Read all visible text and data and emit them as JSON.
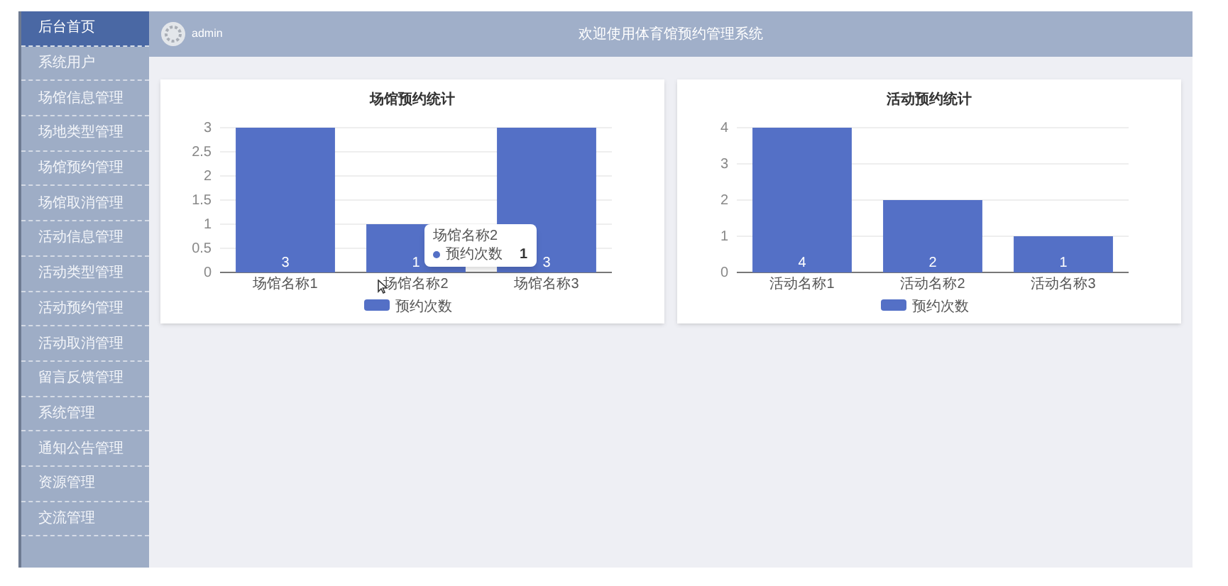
{
  "sidebar": {
    "items": [
      {
        "label": "后台首页",
        "selected": true
      },
      {
        "label": "系统用户",
        "selected": false
      },
      {
        "label": "场馆信息管理",
        "selected": false
      },
      {
        "label": "场地类型管理",
        "selected": false
      },
      {
        "label": "场馆预约管理",
        "selected": false
      },
      {
        "label": "场馆取消管理",
        "selected": false
      },
      {
        "label": "活动信息管理",
        "selected": false
      },
      {
        "label": "活动类型管理",
        "selected": false
      },
      {
        "label": "活动预约管理",
        "selected": false
      },
      {
        "label": "活动取消管理",
        "selected": false
      },
      {
        "label": "留言反馈管理",
        "selected": false
      },
      {
        "label": "系统管理",
        "selected": false
      },
      {
        "label": "通知公告管理",
        "selected": false
      },
      {
        "label": "资源管理",
        "selected": false
      },
      {
        "label": "交流管理",
        "selected": false
      }
    ]
  },
  "header": {
    "user": "admin",
    "title": "欢迎使用体育馆预约管理系统"
  },
  "panels": [
    {
      "chart_data": {
        "type": "bar",
        "title": "场馆预约统计",
        "categories": [
          "场馆名称1",
          "场馆名称2",
          "场馆名称3"
        ],
        "series": [
          {
            "name": "预约次数",
            "color": "#5470c6",
            "values": [
              3,
              1,
              3
            ]
          }
        ],
        "ylim": [
          0,
          3
        ],
        "grid": true,
        "yticks": [
          0,
          0.5,
          1,
          1.5,
          2,
          2.5,
          3
        ],
        "data_labels": true
      },
      "tooltip": {
        "title": "场馆名称2",
        "series": "预约次数",
        "value": "1"
      }
    },
    {
      "chart_data": {
        "type": "bar",
        "title": "活动预约统计",
        "categories": [
          "活动名称1",
          "活动名称2",
          "活动名称3"
        ],
        "series": [
          {
            "name": "预约次数",
            "color": "#5470c6",
            "values": [
              4,
              2,
              1
            ]
          }
        ],
        "ylim": [
          0,
          4
        ],
        "grid": true,
        "yticks": [
          0,
          1,
          2,
          3,
          4
        ],
        "data_labels": true
      }
    }
  ]
}
